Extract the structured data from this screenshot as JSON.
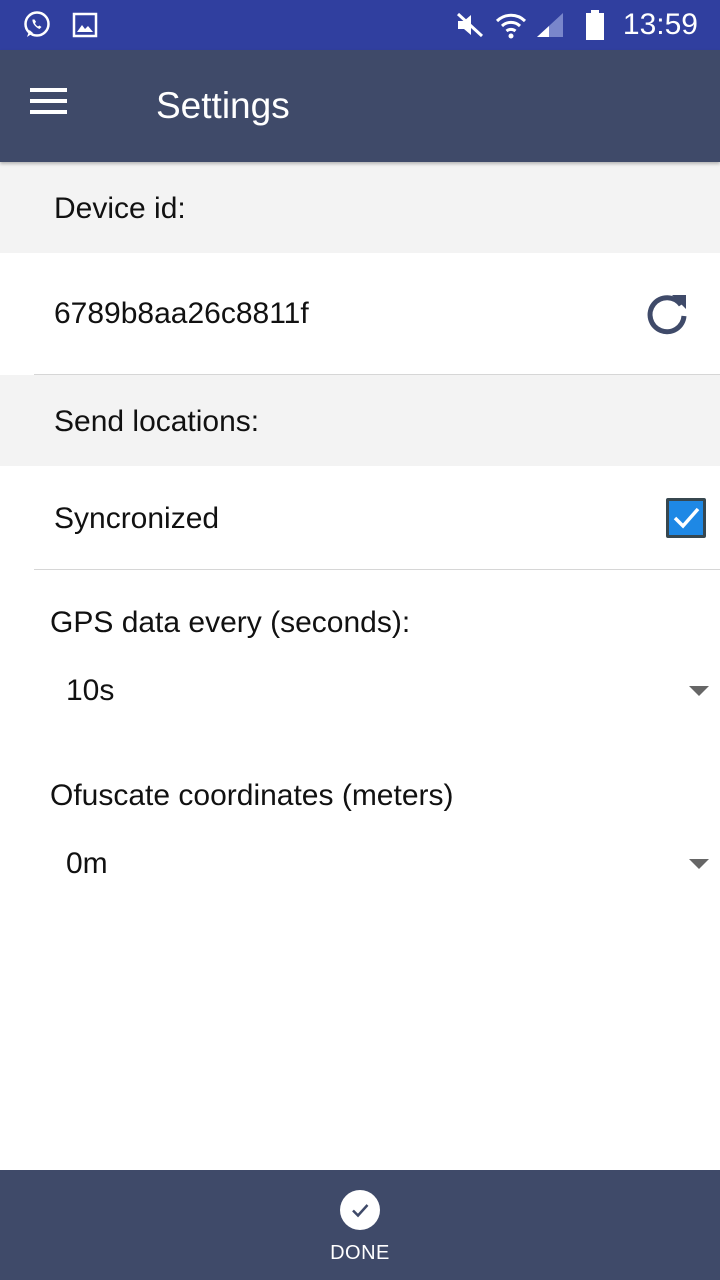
{
  "status_bar": {
    "time": "13:59",
    "icons": [
      "whatsapp-icon",
      "image-icon",
      "mute-icon",
      "wifi-icon",
      "signal-icon",
      "battery-icon"
    ]
  },
  "app_bar": {
    "title": "Settings",
    "menu_icon": "hamburger-menu-icon"
  },
  "device": {
    "header": "Device id:",
    "id": "6789b8aa26c8811f",
    "refresh_icon": "refresh-icon"
  },
  "send_locations": {
    "header": "Send locations:",
    "sync_label": "Syncronized",
    "sync_checked": true
  },
  "gps": {
    "label": "GPS data every (seconds):",
    "value": "10s"
  },
  "ofuscate": {
    "label": "Ofuscate coordinates (meters)",
    "value": "0m"
  },
  "bottom_bar": {
    "done_label": "DONE",
    "done_icon": "check-circle-icon"
  },
  "colors": {
    "status_bar": "#303f9f",
    "app_bar": "#3f4a69",
    "section_bg": "#f3f3f3",
    "checkbox": "#1e88e5"
  }
}
